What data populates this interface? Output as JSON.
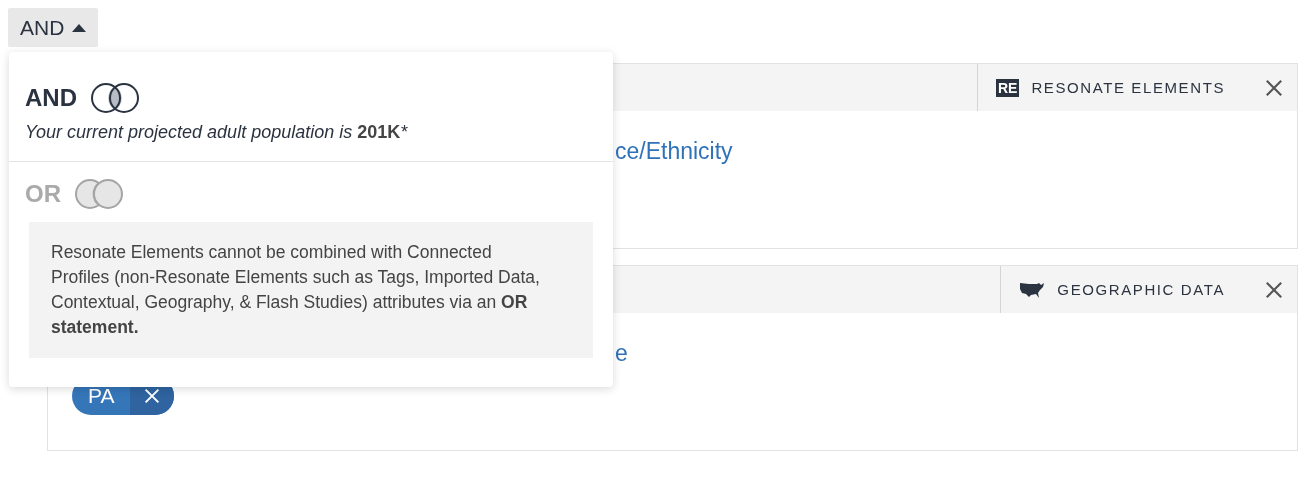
{
  "operator_button": {
    "label": "AND",
    "expanded": true
  },
  "operator_menu": {
    "options": [
      {
        "label": "AND",
        "kind": "and",
        "selected": true,
        "note": "Your current projected adult population is **201K***"
      },
      {
        "label": "OR",
        "kind": "or",
        "selected": false,
        "warning": "Resonate Elements cannot be combined with Connected Profiles (non-Resonate Elements such as Tags, Imported Data, Contextual, Geography, & Flash Studies) attributes via an **OR statement.**"
      }
    ]
  },
  "cards": [
    {
      "source": {
        "kind": "re",
        "icon_text": "RE",
        "label": "RESONATE ELEMENTS"
      },
      "link": "ce/Ethnicity"
    },
    {
      "source": {
        "kind": "geo",
        "label": "GEOGRAPHIC DATA"
      },
      "link": "e",
      "chips": [
        {
          "label": "PA"
        }
      ]
    }
  ]
}
